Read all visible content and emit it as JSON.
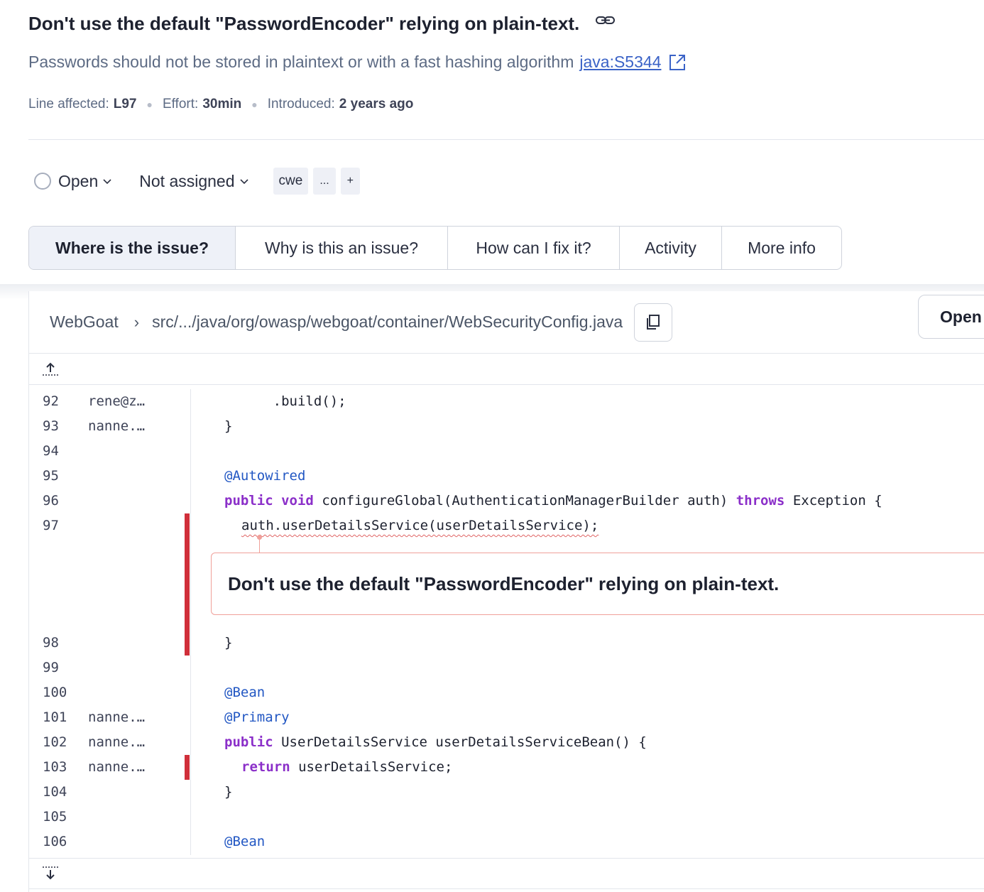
{
  "issue": {
    "title": "Don't use the default \"PasswordEncoder\" relying on plain-text.",
    "description": "Passwords should not be stored in plaintext or with a fast hashing algorithm",
    "rule_link": "java:S5344",
    "meta": {
      "line_label": "Line affected:",
      "line_value": "L97",
      "effort_label": "Effort:",
      "effort_value": "30min",
      "introduced_label": "Introduced:",
      "introduced_value": "2 years ago"
    }
  },
  "status_bar": {
    "status": "Open",
    "assignee": "Not assigned",
    "tags": [
      "cwe",
      "...",
      "+"
    ]
  },
  "tabs": [
    {
      "label": "Where is the issue?",
      "active": true
    },
    {
      "label": "Why is this an issue?",
      "active": false
    },
    {
      "label": "How can I fix it?",
      "active": false
    },
    {
      "label": "Activity",
      "active": false
    },
    {
      "label": "More info",
      "active": false
    }
  ],
  "file": {
    "project": "WebGoat",
    "path": "src/.../java/org/owasp/webgoat/container/WebSecurityConfig.java",
    "open_button": "Open"
  },
  "code_lines": [
    {
      "num": "92",
      "blame": "rene@z…",
      "text": "      .build();"
    },
    {
      "num": "93",
      "blame": "nanne.…",
      "text": "}"
    },
    {
      "num": "94",
      "blame": "",
      "text": ""
    },
    {
      "num": "95",
      "blame": "",
      "text": "@Autowired"
    },
    {
      "num": "96",
      "blame": "",
      "text_parts": [
        "public",
        "void",
        "configureGlobal(AuthenticationManagerBuilder auth)",
        "throws",
        "Exception {"
      ]
    },
    {
      "num": "97",
      "blame": "",
      "text": "auth.userDetailsService(userDetailsService);"
    },
    {
      "num": "98",
      "blame": "",
      "text": "}"
    },
    {
      "num": "99",
      "blame": "",
      "text": ""
    },
    {
      "num": "100",
      "blame": "",
      "text": "@Bean"
    },
    {
      "num": "101",
      "blame": "nanne.…",
      "text": "@Primary"
    },
    {
      "num": "102",
      "blame": "nanne.…",
      "text_parts": [
        "public",
        "UserDetailsService userDetailsServiceBean() {"
      ]
    },
    {
      "num": "103",
      "blame": "nanne.…",
      "text_parts": [
        "return",
        "userDetailsService;"
      ]
    },
    {
      "num": "104",
      "blame": "",
      "text": "}"
    },
    {
      "num": "105",
      "blame": "",
      "text": ""
    },
    {
      "num": "106",
      "blame": "",
      "text": "@Bean"
    }
  ],
  "inline_issue": "Don't use the default \"PasswordEncoder\" relying on plain-text.",
  "colors": {
    "accent_link": "#3b63c7",
    "issue_marker": "#d02f3a",
    "keyword": "#8b2fc9",
    "annotation": "#2257c3"
  }
}
